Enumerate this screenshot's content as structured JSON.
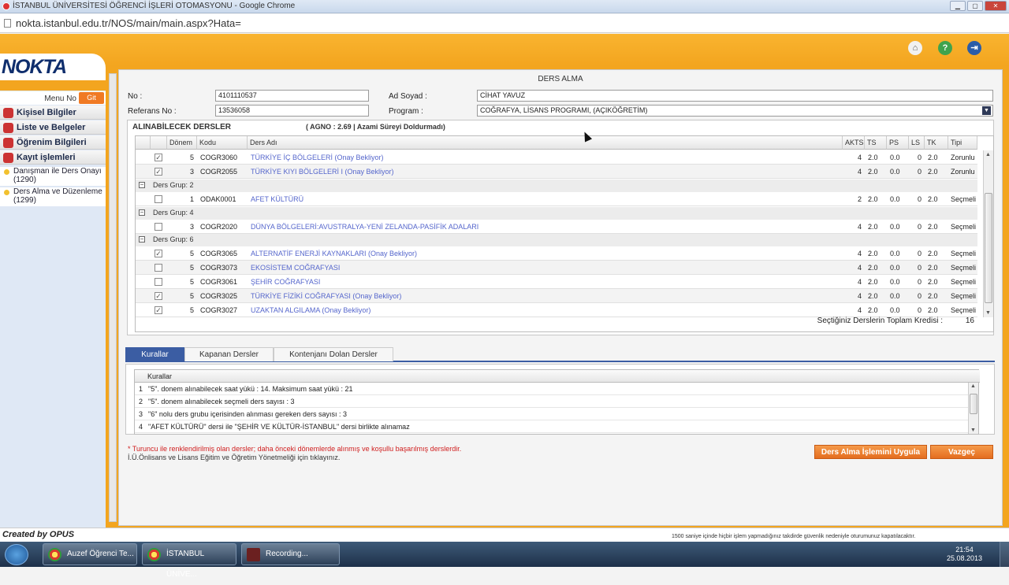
{
  "window": {
    "title": "İSTANBUL ÜNİVERSİTESİ ÖĞRENCİ İŞLERİ OTOMASYONU - Google Chrome"
  },
  "browser": {
    "url": "nokta.istanbul.edu.tr/NOS/main/main.aspx?Hata="
  },
  "logo": "NOKTA",
  "sidebar": {
    "menu_no_label": "Menu No",
    "go_button": "Git",
    "items": [
      "Kişisel Bilgiler",
      "Liste ve Belgeler",
      "Öğrenim Bilgileri",
      "Kayıt işlemleri"
    ],
    "subitems": [
      "Danışman ile Ders Onayı (1290)",
      "Ders Alma ve Düzenleme (1299)"
    ]
  },
  "form": {
    "title": "DERS ALMA",
    "no_label": "No :",
    "no_value": "4101110537",
    "ref_label": "Referans No :",
    "ref_value": "13536058",
    "name_label": "Ad Soyad :",
    "name_value": "CİHAT YAVUZ",
    "program_label": "Program :",
    "program_value": "COĞRAFYA, LİSANS PROGRAMI, (AÇIKÖĞRETİM)"
  },
  "courses": {
    "header": "ALINABİLECEK DERSLER",
    "agno": "( AGNO : 2.69 | Azami Süreyi Doldurmadı)",
    "columns": {
      "donem": "Dönem",
      "kodu": "Kodu",
      "ad": "Ders Adı",
      "akts": "AKTS",
      "ts": "TS",
      "ps": "PS",
      "ls": "LS",
      "tk": "TK",
      "tipi": "Tipi"
    },
    "rows": [
      {
        "kind": "course",
        "checked": true,
        "donem": "5",
        "kodu": "COGR3060",
        "ad": "TÜRKİYE İÇ BÖLGELERİ (Onay Bekliyor)",
        "akts": "4",
        "ts": "2.0",
        "ps": "0.0",
        "ls": "0",
        "tk": "2.0",
        "tipi": "Zorunlu"
      },
      {
        "kind": "course",
        "checked": true,
        "donem": "3",
        "kodu": "COGR2055",
        "ad": "TÜRKİYE KIYI BÖLGELERİ I (Onay Bekliyor)",
        "akts": "4",
        "ts": "2.0",
        "ps": "0.0",
        "ls": "0",
        "tk": "2.0",
        "tipi": "Zorunlu"
      },
      {
        "kind": "group",
        "label": "Ders Grup: 2"
      },
      {
        "kind": "course",
        "checked": false,
        "donem": "1",
        "kodu": "ODAK0001",
        "ad": "AFET KÜLTÜRÜ",
        "akts": "2",
        "ts": "2.0",
        "ps": "0.0",
        "ls": "0",
        "tk": "2.0",
        "tipi": "Seçmeli"
      },
      {
        "kind": "group",
        "label": "Ders Grup: 4"
      },
      {
        "kind": "course",
        "checked": false,
        "donem": "3",
        "kodu": "COGR2020",
        "ad": "DÜNYA BÖLGELERİ:AVUSTRALYA-YENİ ZELANDA-PASİFİK ADALARI",
        "akts": "4",
        "ts": "2.0",
        "ps": "0.0",
        "ls": "0",
        "tk": "2.0",
        "tipi": "Seçmeli"
      },
      {
        "kind": "group",
        "label": "Ders Grup: 6"
      },
      {
        "kind": "course",
        "checked": true,
        "donem": "5",
        "kodu": "COGR3065",
        "ad": "ALTERNATİF ENERJİ KAYNAKLARI (Onay Bekliyor)",
        "akts": "4",
        "ts": "2.0",
        "ps": "0.0",
        "ls": "0",
        "tk": "2.0",
        "tipi": "Seçmeli"
      },
      {
        "kind": "course",
        "checked": false,
        "donem": "5",
        "kodu": "COGR3073",
        "ad": "EKOSİSTEM COĞRAFYASI",
        "akts": "4",
        "ts": "2.0",
        "ps": "0.0",
        "ls": "0",
        "tk": "2.0",
        "tipi": "Seçmeli"
      },
      {
        "kind": "course",
        "checked": false,
        "donem": "5",
        "kodu": "COGR3061",
        "ad": "ŞEHİR COĞRAFYASI",
        "akts": "4",
        "ts": "2.0",
        "ps": "0.0",
        "ls": "0",
        "tk": "2.0",
        "tipi": "Seçmeli"
      },
      {
        "kind": "course",
        "checked": true,
        "donem": "5",
        "kodu": "COGR3025",
        "ad": "TÜRKİYE FİZİKİ COĞRAFYASI (Onay Bekliyor)",
        "akts": "4",
        "ts": "2.0",
        "ps": "0.0",
        "ls": "0",
        "tk": "2.0",
        "tipi": "Seçmeli"
      },
      {
        "kind": "course",
        "checked": true,
        "donem": "5",
        "kodu": "COGR3027",
        "ad": "UZAKTAN ALGILAMA (Onay Bekliyor)",
        "akts": "4",
        "ts": "2.0",
        "ps": "0.0",
        "ls": "0",
        "tk": "2.0",
        "tipi": "Seçmeli"
      }
    ],
    "credit_label": "Seçtiğiniz Derslerin Toplam Kredisi :",
    "credit_value": "16"
  },
  "tabs": [
    "Kurallar",
    "Kapanan Dersler",
    "Kontenjanı Dolan Dersler"
  ],
  "rules": {
    "header": "Kurallar",
    "items": [
      "\"5\". donem alınabilecek saat yükü : 14. Maksimum saat yükü : 21",
      "\"5\". donem alınabilecek seçmeli ders sayısı : 3",
      "\"6\" nolu ders grubu içerisinden alınması gereken ders sayısı : 3",
      "\"AFET KÜLTÜRÜ\" dersi ile \"ŞEHİR VE KÜLTÜR-İSTANBUL\" dersi birlikte alınamaz"
    ]
  },
  "notes": {
    "line1": "* Turuncu ile renklendirilmiş olan dersler; daha önceki dönemlerde alınmış ve koşullu başarılmış derslerdir.",
    "line2": "İ.Ü.Önlisans ve Lisans Eğitim ve Öğretim Yönetmeliği için tıklayınız."
  },
  "buttons": {
    "apply": "Ders Alma İşlemini Uygula",
    "cancel": "Vazgeç"
  },
  "footer": {
    "created_by": "Created by OPUS",
    "message": "1500 saniye içinde hiçbir işlem yapmadığınız takdirde güvenlik nedeniyle oturumunuz kapatılacaktır."
  },
  "taskbar": {
    "items": [
      "Auzef Öğrenci Te...",
      "İSTANBUL ÜNİVE...",
      "Recording..."
    ],
    "time": "21:54",
    "date": "25.08.2013"
  }
}
